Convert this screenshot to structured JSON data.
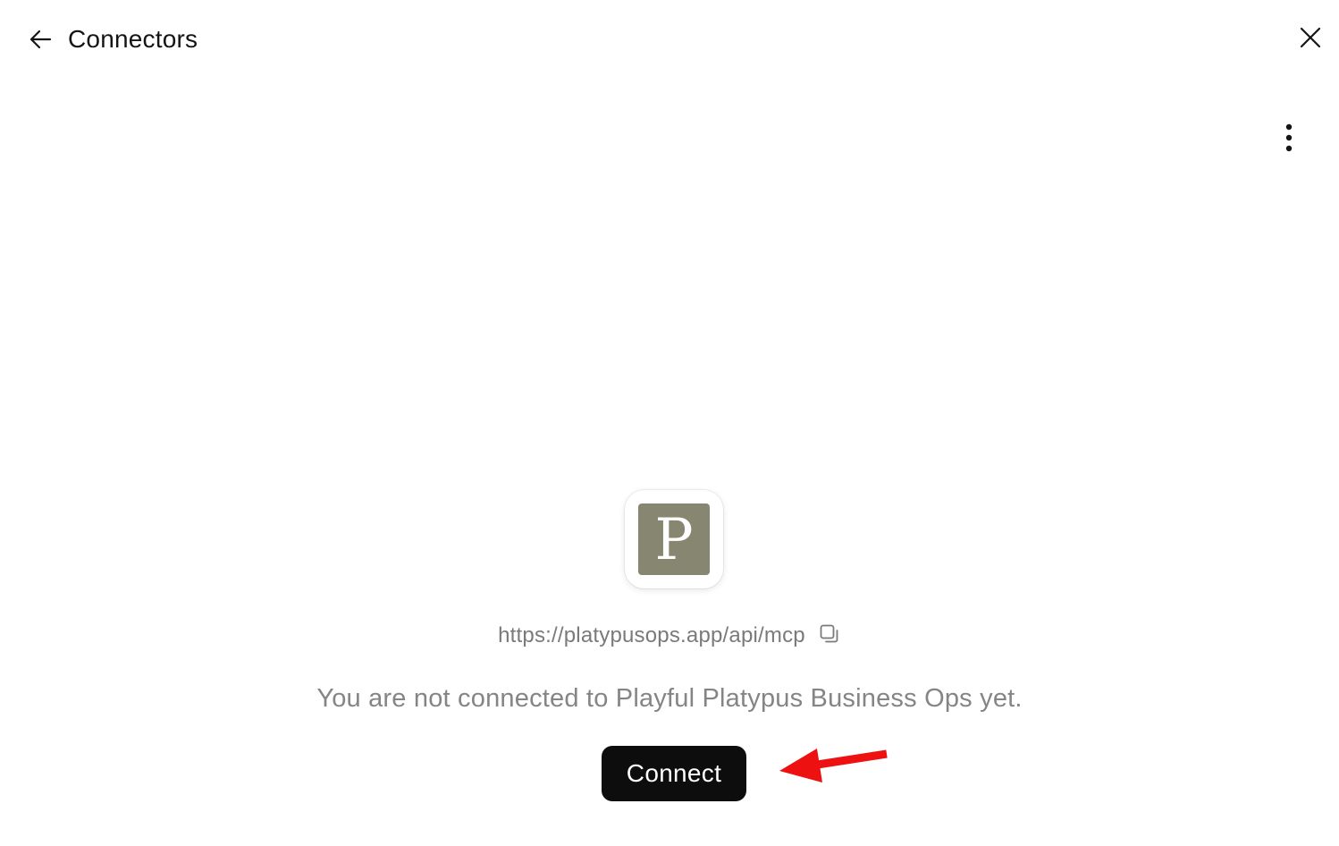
{
  "header": {
    "title": "Connectors",
    "back_icon": "arrow-left-icon",
    "close_icon": "close-icon",
    "more_icon": "more-vertical-icon"
  },
  "connector": {
    "logo_letter": "P",
    "logo_color": "#878670",
    "url": "https://platypusops.app/api/mcp",
    "copy_icon": "copy-icon",
    "status_message": "You are not connected to Playful Platypus Business Ops yet.",
    "connect_label": "Connect"
  },
  "annotation": {
    "arrow_color": "#ee1111"
  }
}
